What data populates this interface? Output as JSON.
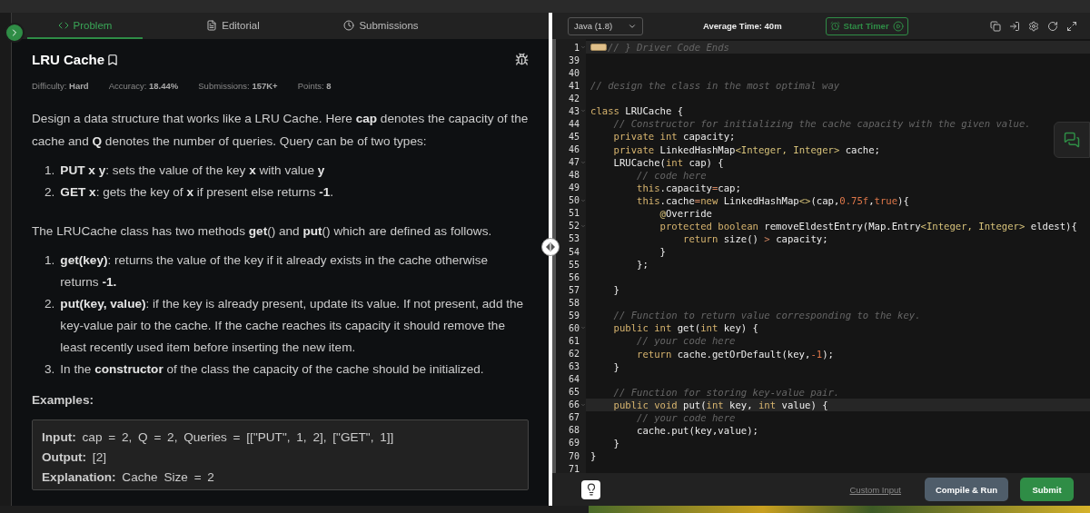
{
  "problem_tabs": [
    {
      "label": "Problem",
      "selected": true
    },
    {
      "label": "Editorial",
      "selected": false
    },
    {
      "label": "Submissions",
      "selected": false
    }
  ],
  "problem": {
    "title": "LRU Cache",
    "meta": [
      {
        "label": "Difficulty:",
        "value": "Hard"
      },
      {
        "label": "Accuracy:",
        "value": "18.44%"
      },
      {
        "label": "Submissions:",
        "value": "157K+"
      },
      {
        "label": "Points:",
        "value": "8"
      }
    ],
    "blocks": [
      {
        "kind": "paragraph",
        "text": "Design a data structure that works like a LRU Cache. Here **cap** denotes the capacity of the cache and **Q** denotes the number of queries. Query can be of two types:"
      },
      {
        "kind": "list",
        "items": [
          {
            "marker": "1.",
            "text": "**PUT x y**: sets the value of the key **x** with value **y**"
          },
          {
            "marker": "2.",
            "text": "**GET x**: gets the key of **x** if present else returns **-1**."
          }
        ]
      },
      {
        "kind": "paragraph",
        "text": "The LRUCache class has two methods **get**() and **put**() which are defined as follows."
      },
      {
        "kind": "list",
        "items": [
          {
            "marker": "1.",
            "text": "**get(key)**: returns the value of the key if it already exists in the cache otherwise returns **-1.**"
          },
          {
            "marker": "2.",
            "text": "**put(key, value)**: if the key is already present, update its value. If not present, add the key-value pair to the cache. If the cache reaches its capacity it should remove the least recently used item before inserting the new item."
          },
          {
            "marker": "3.",
            "text": "In the **constructor** of the class the capacity of the cache should be initialized."
          }
        ]
      },
      {
        "kind": "heading",
        "text": "Examples:"
      },
      {
        "kind": "example",
        "lines": [
          {
            "label": "Input:",
            "value": "cap = 2, Q = 2, Queries = [[\"PUT\", 1, 2], [\"GET\", 1]]"
          },
          {
            "label": "Output:",
            "value": "[2]"
          },
          {
            "label": "Explanation:",
            "value": "Cache Size = 2"
          }
        ]
      }
    ]
  },
  "editor": {
    "language": "Java (1.8)",
    "average_time": "Average Time: 40m",
    "timer_button": "Start Timer",
    "lines": [
      {
        "number": "1",
        "fold": true,
        "collapsed": true,
        "highlighted": true,
        "tokens": [
          {
            "kind": "comment",
            "text": "// } Driver Code Ends"
          }
        ]
      },
      {
        "number": "39",
        "fold": false,
        "collapsed": false,
        "highlighted": false
      },
      {
        "number": "40",
        "fold": false,
        "collapsed": false,
        "highlighted": false
      },
      {
        "number": "41",
        "fold": false,
        "collapsed": false,
        "highlighted": false,
        "tokens": [
          {
            "kind": "comment",
            "text": "// design the class in the most optimal way"
          }
        ]
      },
      {
        "number": "42",
        "fold": false,
        "collapsed": false,
        "highlighted": false
      },
      {
        "number": "43",
        "fold": true,
        "collapsed": false,
        "highlighted": false,
        "tokens": [
          {
            "kind": "keyword",
            "text": "class"
          },
          {
            "kind": "plain",
            "text": " LRUCache {"
          }
        ]
      },
      {
        "number": "44",
        "fold": false,
        "collapsed": false,
        "highlighted": false,
        "tokens": [
          {
            "kind": "comment",
            "text": "    // Constructor for initializing the cache capacity with the given value."
          }
        ]
      },
      {
        "number": "45",
        "fold": false,
        "collapsed": false,
        "highlighted": false,
        "tokens": [
          {
            "kind": "keyword",
            "text": "    private int"
          },
          {
            "kind": "plain",
            "text": " capacity;"
          }
        ]
      },
      {
        "number": "46",
        "fold": false,
        "collapsed": false,
        "highlighted": false,
        "tokens": [
          {
            "kind": "keyword",
            "text": "    private"
          },
          {
            "kind": "plain",
            "text": " LinkedHashMap"
          },
          {
            "kind": "type",
            "text": "<Integer, Integer>"
          },
          {
            "kind": "plain",
            "text": " cache;"
          }
        ]
      },
      {
        "number": "47",
        "fold": true,
        "collapsed": false,
        "highlighted": false,
        "tokens": [
          {
            "kind": "plain",
            "text": "    LRUCache("
          },
          {
            "kind": "keyword",
            "text": "int"
          },
          {
            "kind": "plain",
            "text": " cap) {"
          }
        ]
      },
      {
        "number": "48",
        "fold": false,
        "collapsed": false,
        "highlighted": false,
        "tokens": [
          {
            "kind": "comment",
            "text": "        // code here"
          }
        ]
      },
      {
        "number": "49",
        "fold": false,
        "collapsed": false,
        "highlighted": false,
        "tokens": [
          {
            "kind": "keyword",
            "text": "        this"
          },
          {
            "kind": "plain",
            "text": ".capacity"
          },
          {
            "kind": "operator",
            "text": "="
          },
          {
            "kind": "plain",
            "text": "cap;"
          }
        ]
      },
      {
        "number": "50",
        "fold": true,
        "collapsed": false,
        "highlighted": false,
        "tokens": [
          {
            "kind": "keyword",
            "text": "        this"
          },
          {
            "kind": "plain",
            "text": ".cache"
          },
          {
            "kind": "operator",
            "text": "="
          },
          {
            "kind": "keyword",
            "text": "new"
          },
          {
            "kind": "plain",
            "text": " LinkedHashMap"
          },
          {
            "kind": "type",
            "text": "<>"
          },
          {
            "kind": "plain",
            "text": "(cap,"
          },
          {
            "kind": "number",
            "text": "0.75f"
          },
          {
            "kind": "plain",
            "text": ","
          },
          {
            "kind": "number",
            "text": "true"
          },
          {
            "kind": "plain",
            "text": "){"
          }
        ]
      },
      {
        "number": "51",
        "fold": false,
        "collapsed": false,
        "highlighted": false,
        "tokens": [
          {
            "kind": "type",
            "text": "            @"
          },
          {
            "kind": "plain",
            "text": "Override"
          }
        ]
      },
      {
        "number": "52",
        "fold": true,
        "collapsed": false,
        "highlighted": false,
        "tokens": [
          {
            "kind": "keyword",
            "text": "            protected boolean"
          },
          {
            "kind": "plain",
            "text": " removeEldestEntry(Map.Entry"
          },
          {
            "kind": "type",
            "text": "<Integer, Integer>"
          },
          {
            "kind": "plain",
            "text": " eldest){"
          }
        ]
      },
      {
        "number": "53",
        "fold": false,
        "collapsed": false,
        "highlighted": false,
        "tokens": [
          {
            "kind": "keyword",
            "text": "                return"
          },
          {
            "kind": "plain",
            "text": " size() "
          },
          {
            "kind": "operator",
            "text": ">"
          },
          {
            "kind": "plain",
            "text": " capacity;"
          }
        ]
      },
      {
        "number": "54",
        "fold": false,
        "collapsed": false,
        "highlighted": false,
        "tokens": [
          {
            "kind": "plain",
            "text": "            }"
          }
        ]
      },
      {
        "number": "55",
        "fold": false,
        "collapsed": false,
        "highlighted": false,
        "tokens": [
          {
            "kind": "plain",
            "text": "        };"
          }
        ]
      },
      {
        "number": "56",
        "fold": false,
        "collapsed": false,
        "highlighted": false
      },
      {
        "number": "57",
        "fold": false,
        "collapsed": false,
        "highlighted": false,
        "tokens": [
          {
            "kind": "plain",
            "text": "    }"
          }
        ]
      },
      {
        "number": "58",
        "fold": false,
        "collapsed": false,
        "highlighted": false
      },
      {
        "number": "59",
        "fold": false,
        "collapsed": false,
        "highlighted": false,
        "tokens": [
          {
            "kind": "comment",
            "text": "    // Function to return value corresponding to the key."
          }
        ]
      },
      {
        "number": "60",
        "fold": true,
        "collapsed": false,
        "highlighted": false,
        "tokens": [
          {
            "kind": "keyword",
            "text": "    public int"
          },
          {
            "kind": "plain",
            "text": " get("
          },
          {
            "kind": "keyword",
            "text": "int"
          },
          {
            "kind": "plain",
            "text": " key) {"
          }
        ]
      },
      {
        "number": "61",
        "fold": false,
        "collapsed": false,
        "highlighted": false,
        "tokens": [
          {
            "kind": "comment",
            "text": "        // your code here"
          }
        ]
      },
      {
        "number": "62",
        "fold": false,
        "collapsed": false,
        "highlighted": false,
        "tokens": [
          {
            "kind": "keyword",
            "text": "        return"
          },
          {
            "kind": "plain",
            "text": " cache.getOrDefault(key,"
          },
          {
            "kind": "number",
            "text": "-1"
          },
          {
            "kind": "plain",
            "text": ");"
          }
        ]
      },
      {
        "number": "63",
        "fold": false,
        "collapsed": false,
        "highlighted": false,
        "tokens": [
          {
            "kind": "plain",
            "text": "    }"
          }
        ]
      },
      {
        "number": "64",
        "fold": false,
        "collapsed": false,
        "highlighted": false
      },
      {
        "number": "65",
        "fold": false,
        "collapsed": false,
        "highlighted": false,
        "tokens": [
          {
            "kind": "comment",
            "text": "    // Function for storing key-value pair."
          }
        ]
      },
      {
        "number": "66",
        "fold": true,
        "collapsed": false,
        "highlighted": true,
        "tokens": [
          {
            "kind": "keyword",
            "text": "    public void"
          },
          {
            "kind": "plain",
            "text": " put("
          },
          {
            "kind": "keyword",
            "text": "int"
          },
          {
            "kind": "plain",
            "text": " key, "
          },
          {
            "kind": "keyword",
            "text": "int"
          },
          {
            "kind": "plain",
            "text": " value) {"
          }
        ]
      },
      {
        "number": "67",
        "fold": false,
        "collapsed": false,
        "highlighted": false,
        "tokens": [
          {
            "kind": "comment",
            "text": "        // your code here"
          }
        ]
      },
      {
        "number": "68",
        "fold": false,
        "collapsed": false,
        "highlighted": false,
        "tokens": [
          {
            "kind": "plain",
            "text": "        cache.put(key,value);"
          }
        ]
      },
      {
        "number": "69",
        "fold": false,
        "collapsed": false,
        "highlighted": false,
        "tokens": [
          {
            "kind": "plain",
            "text": "    }"
          }
        ]
      },
      {
        "number": "70",
        "fold": false,
        "collapsed": false,
        "highlighted": false,
        "tokens": [
          {
            "kind": "plain",
            "text": "}"
          }
        ]
      },
      {
        "number": "71",
        "fold": false,
        "collapsed": false,
        "highlighted": false
      }
    ],
    "footer": {
      "link": "Custom Input",
      "buttons": [
        {
          "kind": "secondary",
          "label": "Compile & Run"
        },
        {
          "kind": "primary",
          "label": "Submit"
        }
      ]
    }
  }
}
